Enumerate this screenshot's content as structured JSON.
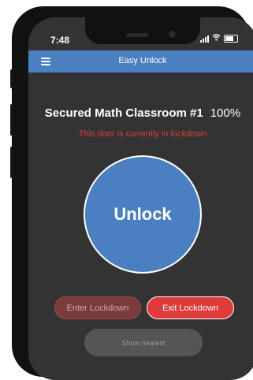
{
  "status_bar": {
    "time": "7:48"
  },
  "header": {
    "title": "Easy Unlock",
    "menu_icon": "hamburger-menu-icon"
  },
  "door": {
    "name": "Secured Math Classroom #1",
    "battery": "100%"
  },
  "lockdown_message": "This door is currently in lockdown",
  "unlock_button": {
    "label": "Unlock"
  },
  "lockdown_controls": {
    "enter_label": "Enter Lockdown",
    "exit_label": "Exit Lockdown"
  },
  "show_nearest": {
    "label": "Show nearest"
  },
  "colors": {
    "accent": "#4a7fc1",
    "alert": "#e03a3a",
    "background": "#333333"
  }
}
